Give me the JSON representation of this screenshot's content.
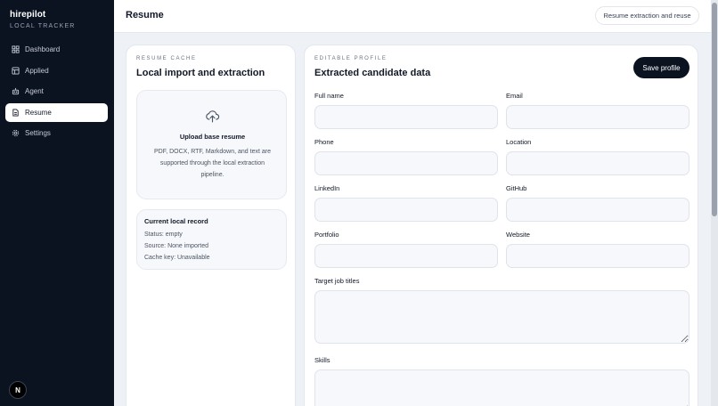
{
  "app": {
    "name": "hirepilot",
    "subtitle": "LOCAL TRACKER"
  },
  "sidebar": {
    "items": [
      {
        "label": "Dashboard",
        "icon": "dashboard-icon",
        "active": false
      },
      {
        "label": "Applied",
        "icon": "table-icon",
        "active": false
      },
      {
        "label": "Agent",
        "icon": "robot-icon",
        "active": false
      },
      {
        "label": "Resume",
        "icon": "document-icon",
        "active": true
      },
      {
        "label": "Settings",
        "icon": "gear-icon",
        "active": false
      }
    ],
    "avatar": "N"
  },
  "header": {
    "title": "Resume",
    "action_label": "Resume extraction and reuse"
  },
  "resume_cache": {
    "eyebrow": "RESUME CACHE",
    "title": "Local import and extraction",
    "upload": {
      "icon": "cloud-upload-icon",
      "title": "Upload base resume",
      "description": "PDF, DOCX, RTF, Markdown, and text are supported through the local extraction pipeline."
    },
    "record": {
      "title": "Current local record",
      "status": "Status: empty",
      "source": "Source: None imported",
      "cache_key": "Cache key: Unavailable"
    }
  },
  "profile": {
    "eyebrow": "EDITABLE PROFILE",
    "title": "Extracted candidate data",
    "save_label": "Save profile",
    "fields": {
      "full_name": {
        "label": "Full name",
        "value": ""
      },
      "email": {
        "label": "Email",
        "value": ""
      },
      "phone": {
        "label": "Phone",
        "value": ""
      },
      "location": {
        "label": "Location",
        "value": ""
      },
      "linkedin": {
        "label": "LinkedIn",
        "value": ""
      },
      "github": {
        "label": "GitHub",
        "value": ""
      },
      "portfolio": {
        "label": "Portfolio",
        "value": ""
      },
      "website": {
        "label": "Website",
        "value": ""
      },
      "target_titles": {
        "label": "Target job titles",
        "value": ""
      },
      "skills": {
        "label": "Skills",
        "value": ""
      }
    }
  },
  "colors": {
    "sidebar_bg": "#0b1220",
    "accent_button": "#0b1220",
    "page_bg": "#eef1f5"
  }
}
